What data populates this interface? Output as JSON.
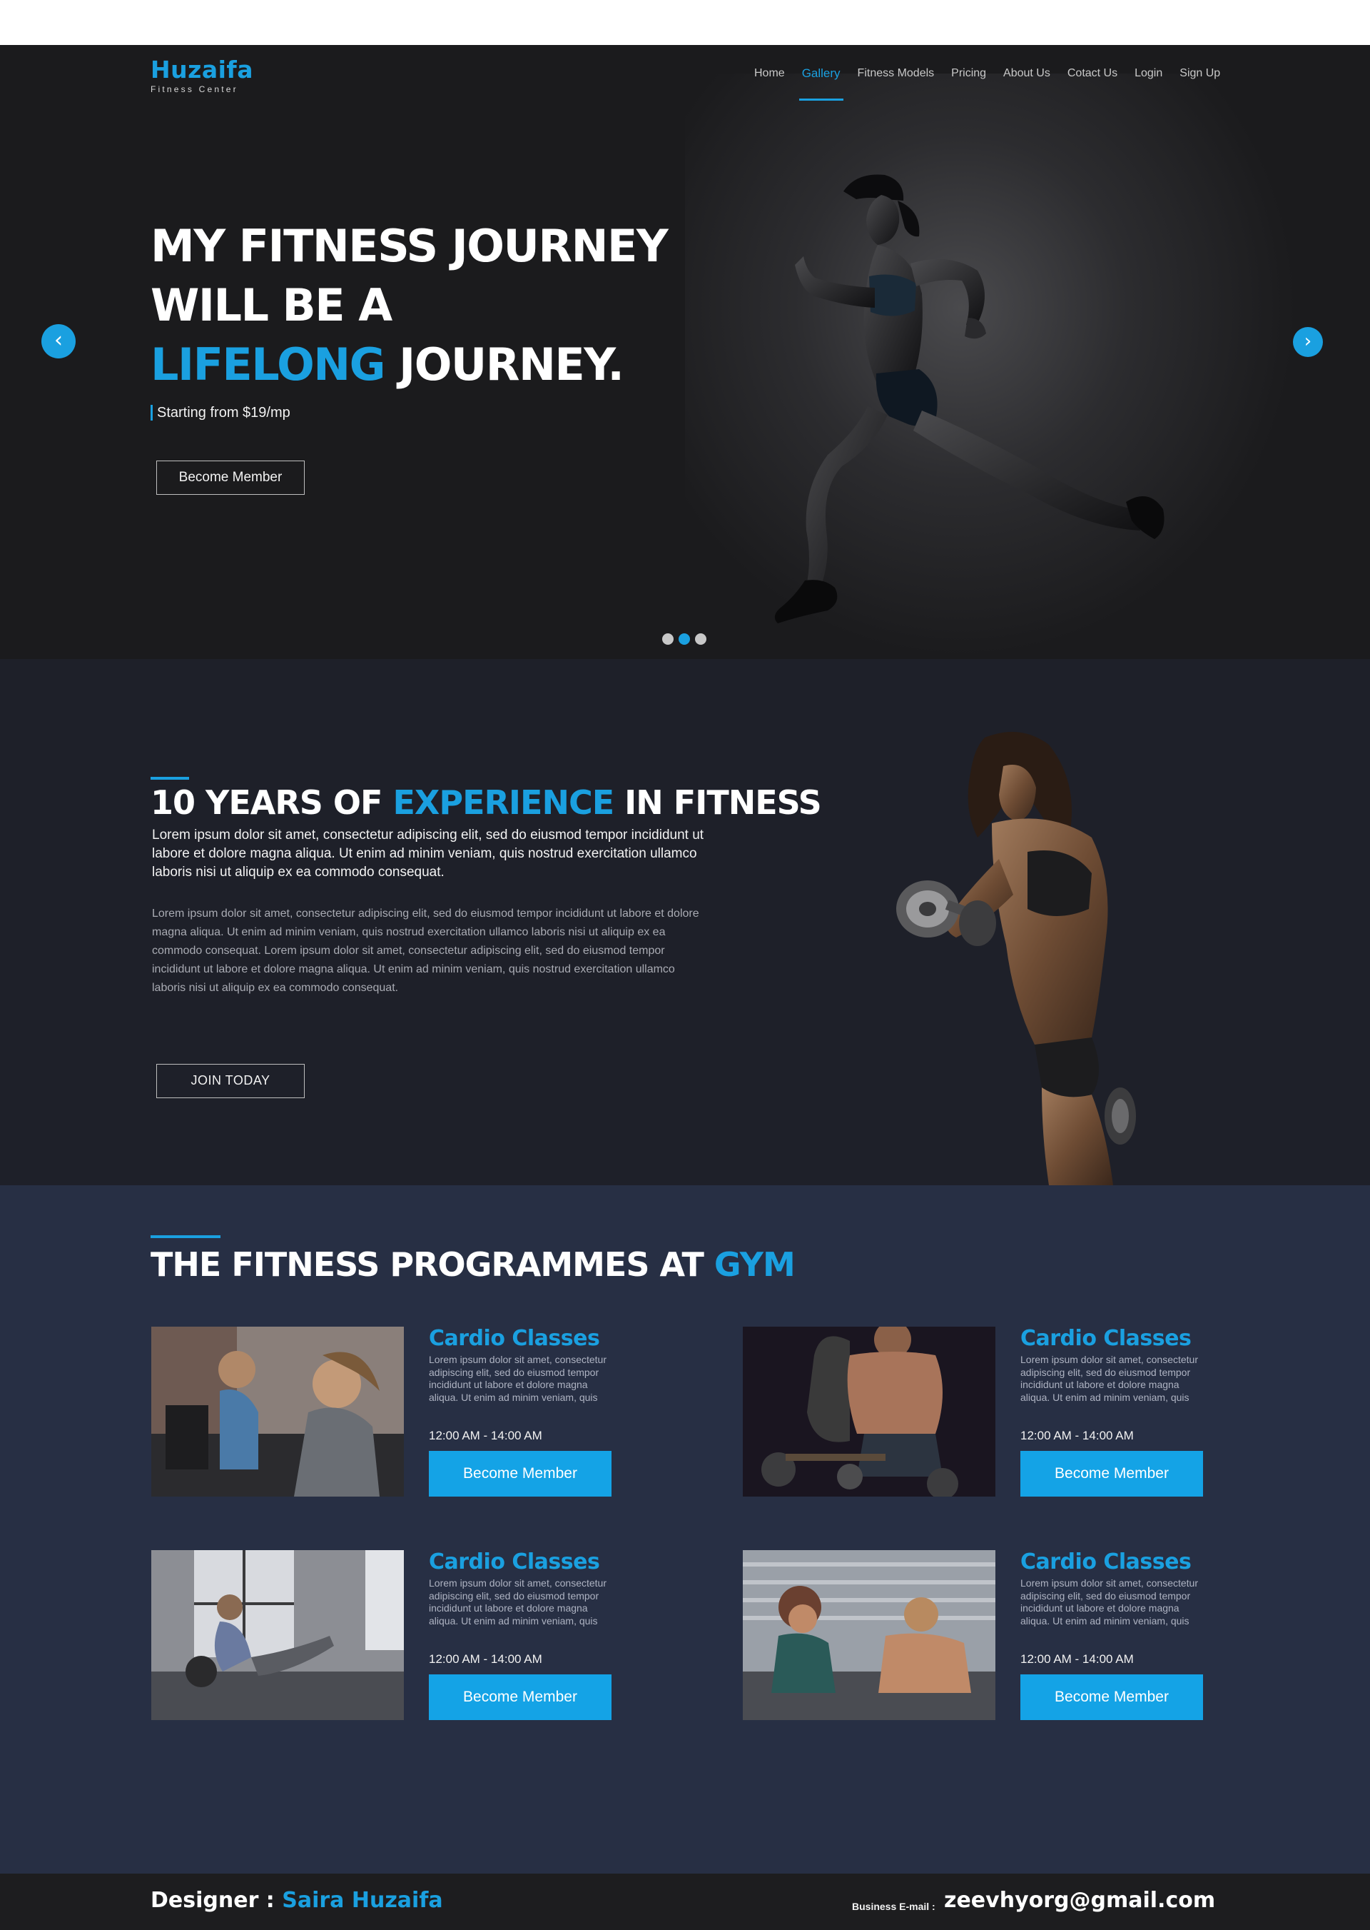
{
  "brand": {
    "name": "Huzaifa",
    "tagline": "Fitness Center"
  },
  "nav": {
    "items": [
      {
        "label": "Home",
        "active": false
      },
      {
        "label": "Gallery",
        "active": true
      },
      {
        "label": "Fitness Models",
        "active": false
      },
      {
        "label": "Pricing",
        "active": false
      },
      {
        "label": "About Us",
        "active": false
      },
      {
        "label": "Cotact Us",
        "active": false
      },
      {
        "label": "Login",
        "active": false
      },
      {
        "label": "Sign Up",
        "active": false
      }
    ]
  },
  "hero": {
    "line1": "MY FITNESS JOURNEY",
    "line2": "WILL BE A",
    "line3_accent": "LIFELONG",
    "line3_rest": " JOURNEY.",
    "price": "Starting from $19/mp",
    "button": "Become Member",
    "prev_icon": "chevron-left-icon",
    "next_icon": "chevron-right-icon",
    "slide_count": 3,
    "active_slide": 2
  },
  "experience": {
    "title_pre": "10 YEARS OF ",
    "title_accent": "EXPERIENCE",
    "title_post": " IN FITNESS",
    "lead": "Lorem ipsum dolor sit amet, consectetur adipiscing elit, sed do eiusmod tempor incididunt ut labore et dolore magna aliqua. Ut enim ad minim veniam, quis nostrud exercitation ullamco laboris nisi ut aliquip ex ea commodo consequat.",
    "body": "Lorem ipsum dolor sit amet, consectetur adipiscing elit, sed do eiusmod tempor incididunt ut labore et dolore magna aliqua. Ut enim ad minim veniam, quis nostrud exercitation ullamco laboris nisi ut aliquip ex ea commodo consequat. Lorem ipsum dolor sit amet, consectetur adipiscing elit, sed do eiusmod tempor incididunt ut labore et dolore magna aliqua. Ut enim ad minim veniam, quis nostrud exercitation ullamco laboris nisi ut aliquip ex ea commodo consequat.",
    "button": "JOIN TODAY"
  },
  "programmes": {
    "title_pre": "THE FITNESS PROGRAMMES AT ",
    "title_accent": "GYM",
    "cards": [
      {
        "title": "Cardio Classes",
        "desc": "Lorem ipsum dolor sit amet, consectetur adipiscing elit, sed do eiusmod tempor incididunt ut labore et dolore magna aliqua. Ut enim ad minim veniam, quis",
        "time": "12:00 AM - 14:00 AM",
        "button": "Become Member"
      },
      {
        "title": "Cardio Classes",
        "desc": "Lorem ipsum dolor sit amet, consectetur adipiscing elit, sed do eiusmod tempor incididunt ut labore et dolore magna aliqua. Ut enim ad minim veniam, quis",
        "time": "12:00 AM - 14:00 AM",
        "button": "Become Member"
      },
      {
        "title": "Cardio Classes",
        "desc": "Lorem ipsum dolor sit amet, consectetur adipiscing elit, sed do eiusmod tempor incididunt ut labore et dolore magna aliqua. Ut enim ad minim veniam, quis",
        "time": "12:00 AM - 14:00 AM",
        "button": "Become Member"
      },
      {
        "title": "Cardio Classes",
        "desc": "Lorem ipsum dolor sit amet, consectetur adipiscing elit, sed do eiusmod tempor incididunt ut labore et dolore magna aliqua. Ut enim ad minim veniam, quis",
        "time": "12:00 AM - 14:00 AM",
        "button": "Become Member"
      }
    ]
  },
  "footer": {
    "designer_label": "Designer : ",
    "designer_name": "Saira Huzaifa",
    "email_label": "Business E-mail : ",
    "email": "zeevhyorg@gmail.com"
  },
  "colors": {
    "accent": "#1aa0e0",
    "hero_bg": "#1b1b1d",
    "experience_bg": "#1e2029",
    "programmes_bg": "#272f44",
    "footer_bg": "#1d1d1f"
  }
}
